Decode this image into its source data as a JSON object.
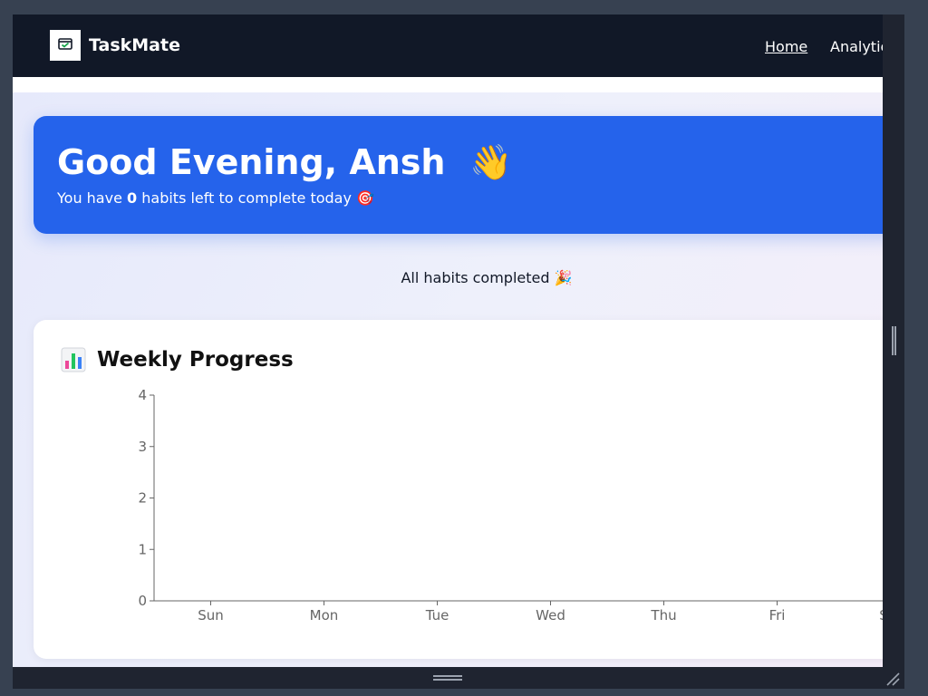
{
  "navbar": {
    "brand": "TaskMate",
    "logo_icon": "checked-calendar-icon",
    "links": [
      "Home",
      "Analytics"
    ]
  },
  "hero": {
    "greeting": "Good Evening, Ansh",
    "greeting_emoji": "👋",
    "subtitle_prefix": "You have ",
    "habits_left": "0",
    "subtitle_suffix": " habits left to complete today 🎯"
  },
  "status": {
    "message": "All habits completed 🎉"
  },
  "weekly_card": {
    "title": "Weekly Progress",
    "title_icon": "bar-chart-icon"
  },
  "chart_data": {
    "type": "bar",
    "categories": [
      "Sun",
      "Mon",
      "Tue",
      "Wed",
      "Thu",
      "Fri",
      "Sat"
    ],
    "values": [
      0,
      0,
      0,
      0,
      0,
      0,
      0
    ],
    "yticks": [
      0,
      1,
      2,
      3,
      4
    ],
    "ylim": [
      0,
      4
    ],
    "title": "",
    "xlabel": "",
    "ylabel": "",
    "grid": false
  },
  "colors": {
    "navbar": "#111827",
    "hero": "#2563eb",
    "background": "#eef0fb"
  }
}
